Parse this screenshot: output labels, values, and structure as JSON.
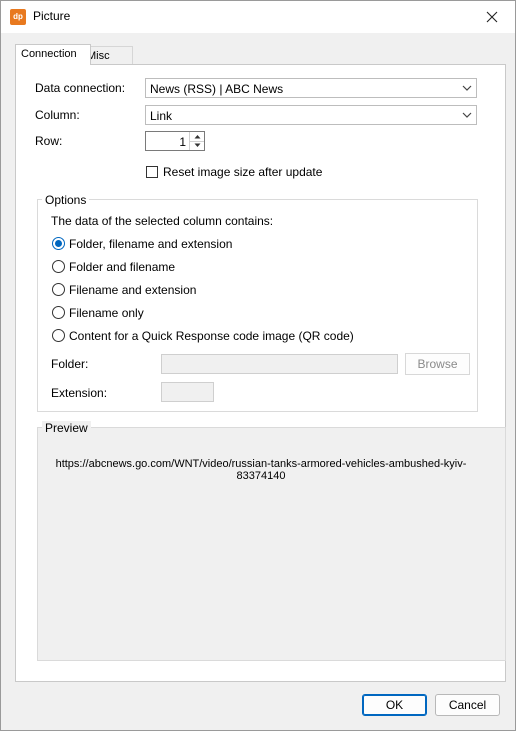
{
  "window": {
    "title": "Picture",
    "icon": "dp-app-icon",
    "icon_text": "dp",
    "close_icon": "close-icon"
  },
  "tabs": [
    {
      "label": "Connection",
      "active": true
    },
    {
      "label": "Misc",
      "active": false
    }
  ],
  "form": {
    "data_connection_label": "Data connection:",
    "data_connection_value": "News (RSS) | ABC News",
    "column_label": "Column:",
    "column_value": "Link",
    "row_label": "Row:",
    "row_value": "1",
    "reset_checkbox_label": "Reset image size after update",
    "reset_checkbox_checked": false
  },
  "options": {
    "group_title": "Options",
    "intro": "The data of the selected column contains:",
    "radios": [
      {
        "label": "Folder, filename and extension",
        "checked": true
      },
      {
        "label": "Folder and filename",
        "checked": false
      },
      {
        "label": "Filename and extension",
        "checked": false
      },
      {
        "label": "Filename only",
        "checked": false
      },
      {
        "label": "Content for a Quick Response code image (QR code)",
        "checked": false
      }
    ],
    "folder_label": "Folder:",
    "folder_value": "",
    "browse_label": "Browse",
    "extension_label": "Extension:",
    "extension_value": ""
  },
  "preview": {
    "group_title": "Preview",
    "text_line1": "https://abcnews.go.com/WNT/video/russian-tanks-armored-vehicles-ambushed-kyiv-",
    "text_line2": "83374140"
  },
  "buttons": {
    "ok": "OK",
    "cancel": "Cancel"
  },
  "colors": {
    "accent": "#0067c0",
    "app_icon": "#e8791f"
  }
}
